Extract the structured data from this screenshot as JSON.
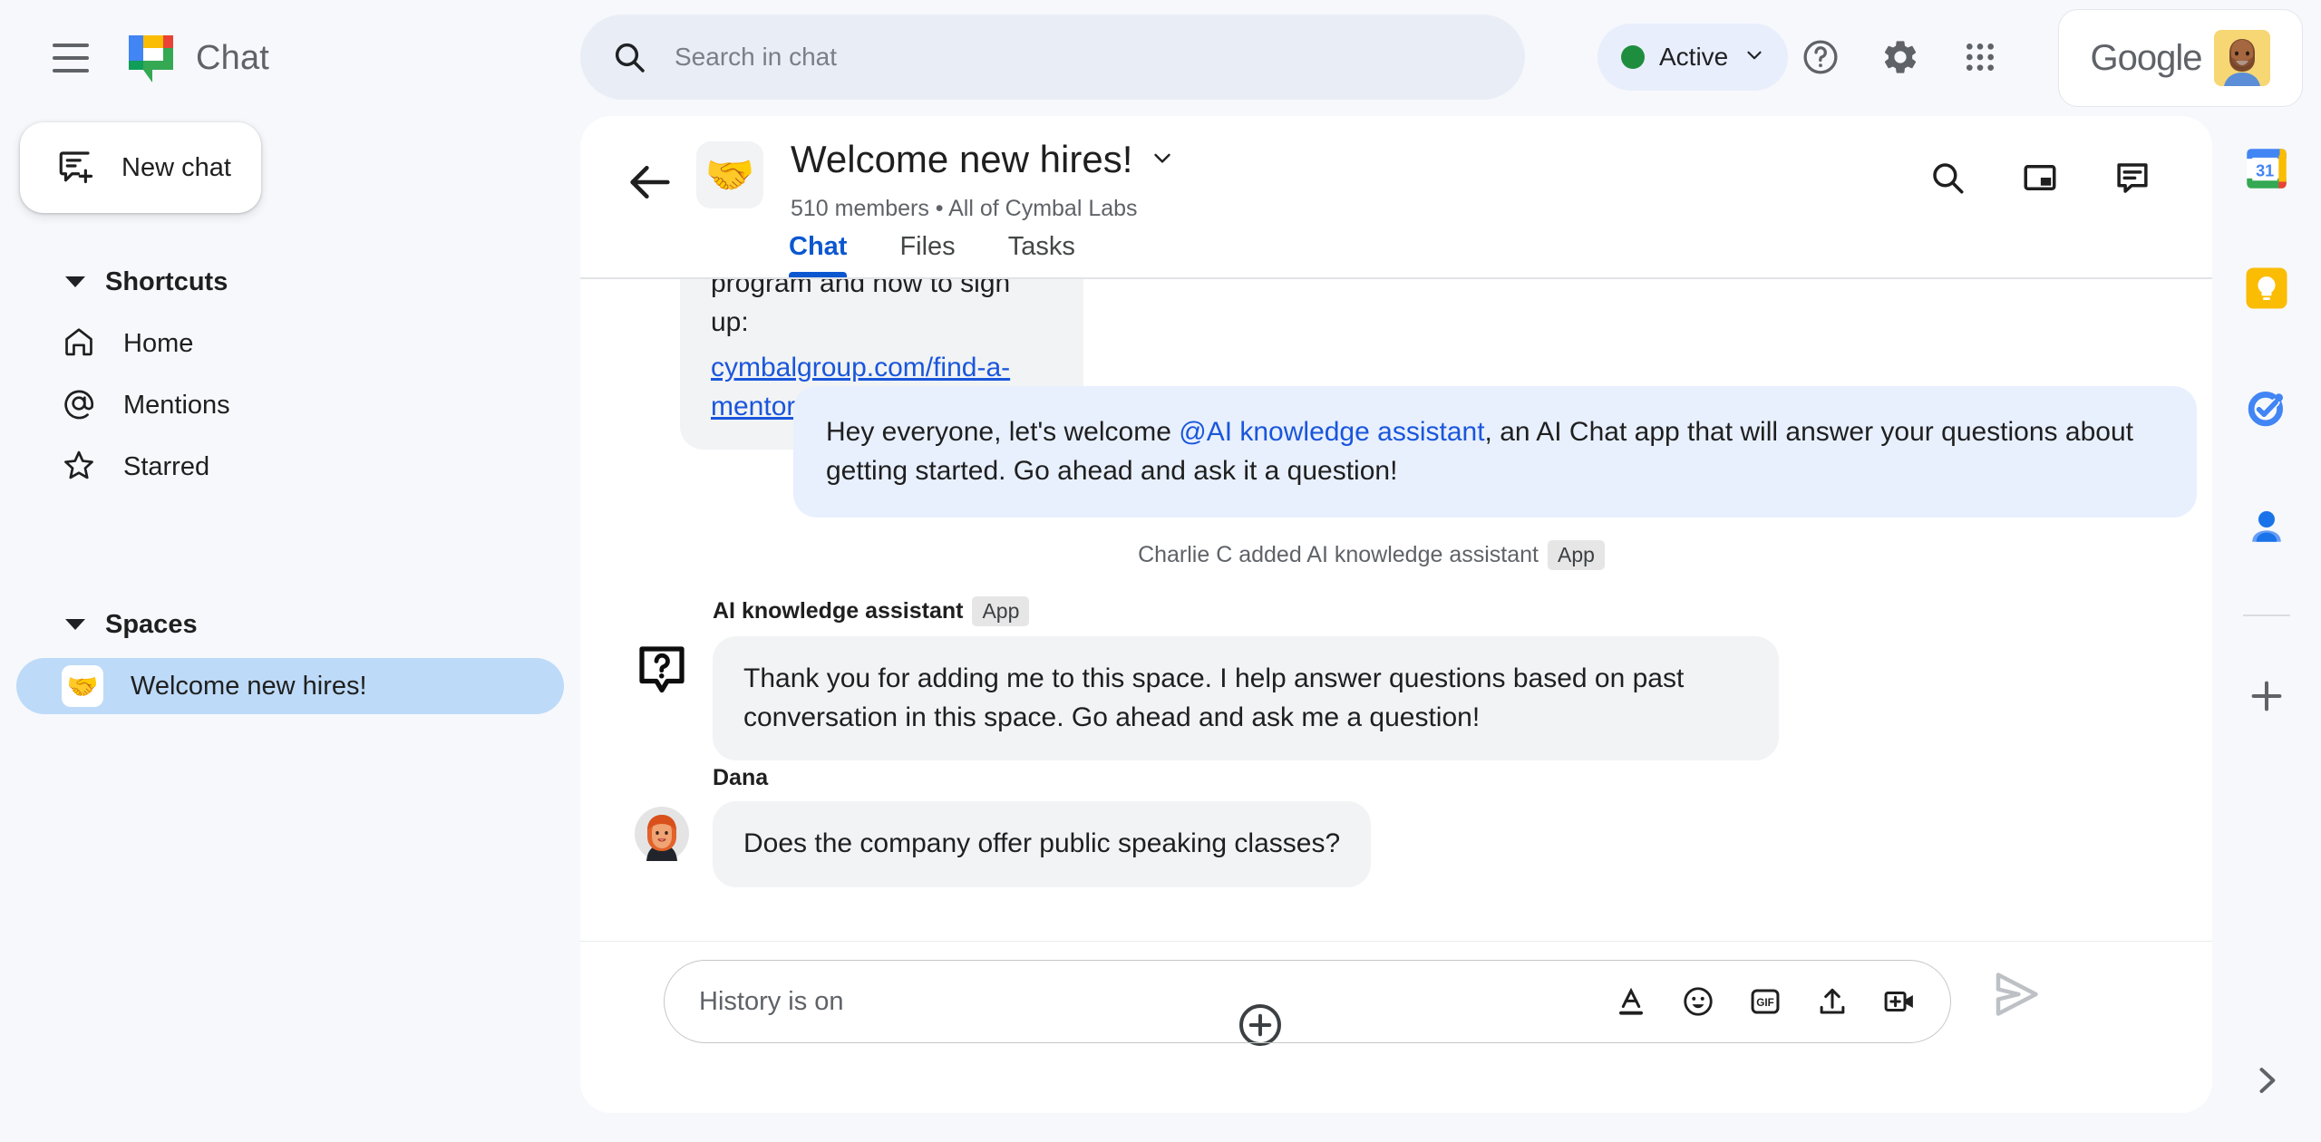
{
  "app": {
    "name": "Chat",
    "logo_icon": "google-chat-logo"
  },
  "topbar": {
    "menu_icon": "hamburger-menu-icon",
    "search": {
      "placeholder": "Search in chat",
      "value": "",
      "icon": "search-icon"
    },
    "status": {
      "label": "Active",
      "dot_color": "#1e8e3e",
      "chevron_icon": "chevron-down-icon"
    },
    "help_icon": "help-circle-icon",
    "settings_icon": "gear-icon",
    "apps_icon": "apps-grid-icon",
    "account": {
      "brand": "Google",
      "avatar_icon": "user-avatar"
    }
  },
  "sidebar": {
    "new_chat": {
      "label": "New chat",
      "icon": "new-chat-icon"
    },
    "shortcuts": {
      "label": "Shortcuts",
      "caret_icon": "caret-down-icon",
      "items": [
        {
          "label": "Home",
          "icon": "home-icon"
        },
        {
          "label": "Mentions",
          "icon": "at-sign-icon"
        },
        {
          "label": "Starred",
          "icon": "star-icon"
        }
      ]
    },
    "spaces": {
      "label": "Spaces",
      "caret_icon": "caret-down-icon",
      "items": [
        {
          "label": "Welcome new hires!",
          "emoji": "🤝",
          "active": true
        }
      ]
    }
  },
  "conversation": {
    "back_icon": "back-arrow-icon",
    "emoji": "🤝",
    "title": "Welcome new hires!",
    "title_chevron_icon": "chevron-down-icon",
    "subtitle": "510 members  •  All of Cymbal Labs",
    "actions": [
      {
        "name": "search-icon"
      },
      {
        "name": "picture-in-picture-icon"
      },
      {
        "name": "conversation-toggle-icon"
      }
    ],
    "tabs": [
      {
        "label": "Chat",
        "active": true
      },
      {
        "label": "Files",
        "active": false
      },
      {
        "label": "Tasks",
        "active": false
      }
    ]
  },
  "messages": {
    "truncated_top": {
      "text_line1": "program and how to sign up:",
      "link": "cymbalgroup.com/find-a-mentor"
    },
    "outgoing": {
      "prefix": "Hey everyone, let's welcome ",
      "mention": "@AI knowledge assistant",
      "suffix": ", an AI Chat app that will answer your questions about getting started.  Go ahead and ask it a question!"
    },
    "system_event": {
      "text": "Charlie C added AI knowledge assistant",
      "badge": "App"
    },
    "assistant": {
      "sender": "AI knowledge assistant",
      "badge": "App",
      "avatar_icon": "question-bubble-icon",
      "text": "Thank you for adding me to this space. I help answer questions based on past conversation in this space. Go ahead and ask me a question!"
    },
    "user": {
      "sender": "Dana",
      "avatar_icon": "dana-avatar",
      "text": "Does the company offer public speaking classes?"
    }
  },
  "composer": {
    "plus_icon": "add-circle-icon",
    "placeholder": "History is on",
    "value": "",
    "icons": [
      {
        "name": "format-text-icon"
      },
      {
        "name": "emoji-icon"
      },
      {
        "name": "gif-icon"
      },
      {
        "name": "upload-icon"
      },
      {
        "name": "add-video-icon"
      }
    ],
    "send_icon": "send-icon"
  },
  "rail": {
    "items": [
      {
        "name": "google-calendar-icon"
      },
      {
        "name": "google-keep-icon"
      },
      {
        "name": "google-tasks-icon"
      },
      {
        "name": "google-contacts-icon"
      }
    ],
    "add_icon": "plus-icon",
    "expand_icon": "chevron-right-icon"
  },
  "colors": {
    "accent": "#0b57d0",
    "page_bg": "#f6f8fc",
    "panel_bg": "#ffffff",
    "bubble_incoming": "#f1f3f4",
    "bubble_outgoing": "#e8f0fe",
    "active_space": "#bddaf8",
    "link": "#1a56db",
    "status_green": "#1e8e3e"
  }
}
